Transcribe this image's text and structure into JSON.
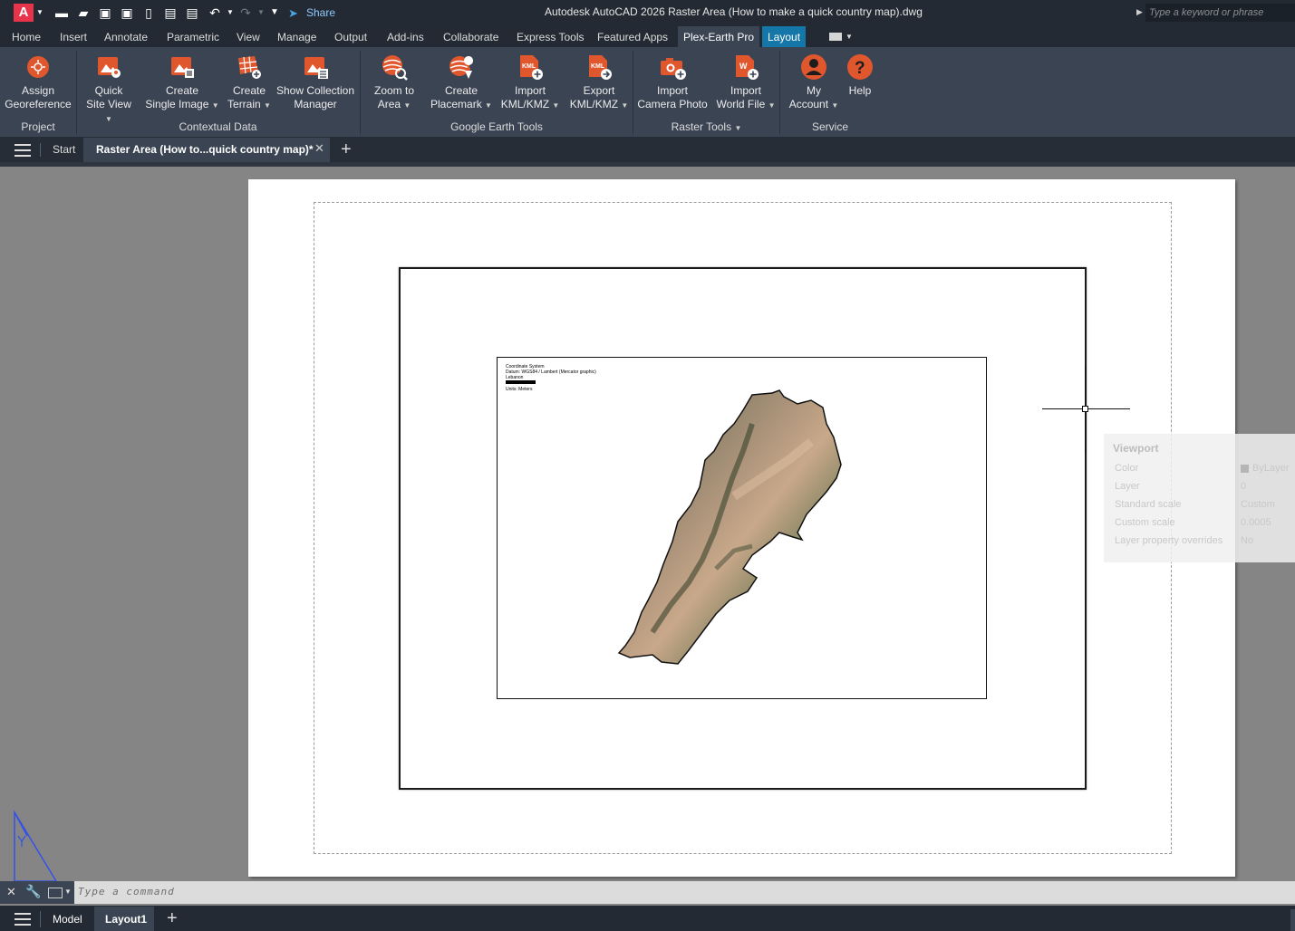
{
  "window": {
    "app_icon_letter": "A",
    "title": "Autodesk AutoCAD 2026    Raster Area (How to make a quick country map).dwg",
    "share_label": "Share",
    "search_placeholder": "Type a keyword or phrase"
  },
  "menu_tabs": [
    "Home",
    "Insert",
    "Annotate",
    "Parametric",
    "View",
    "Manage",
    "Output",
    "Add-ins",
    "Collaborate",
    "Express Tools",
    "Featured Apps",
    "Plex-Earth Pro",
    "Layout"
  ],
  "ribbon": {
    "panels": [
      {
        "title": "Project",
        "buttons": [
          [
            "Assign",
            "Georeference"
          ]
        ]
      },
      {
        "title": "Contextual Data",
        "buttons": [
          [
            "Quick",
            "Site View"
          ],
          [
            "Create",
            "Single Image"
          ],
          [
            "Create",
            "Terrain"
          ],
          [
            "Show Collection",
            "Manager"
          ]
        ]
      },
      {
        "title": "Google Earth Tools",
        "buttons": [
          [
            "Zoom to",
            "Area"
          ],
          [
            "Create",
            "Placemark"
          ],
          [
            "Import",
            "KML/KMZ"
          ],
          [
            "Export",
            "KML/KMZ"
          ]
        ]
      },
      {
        "title": "Raster Tools",
        "buttons": [
          [
            "Import",
            "Camera Photo"
          ],
          [
            "Import",
            "World File"
          ]
        ]
      },
      {
        "title": "Service",
        "buttons": [
          [
            "My",
            "Account"
          ],
          [
            "Help",
            ""
          ]
        ]
      }
    ],
    "kml_badge": "KML",
    "w_badge": "W"
  },
  "doc_tabs": {
    "start": "Start",
    "active": "Raster Area (How to...quick country map)*"
  },
  "map_legend": [
    "Coordinate System",
    "Datum: WGS84 / Lambert (Mercator graphic)",
    "Lebanon",
    "",
    "Units: Meters"
  ],
  "viewport_props": {
    "title": "Viewport",
    "rows": [
      {
        "label": "Color",
        "value": "ByLayer"
      },
      {
        "label": "Layer",
        "value": "0"
      },
      {
        "label": "Standard scale",
        "value": "Custom"
      },
      {
        "label": "Custom scale",
        "value": "0.0005"
      },
      {
        "label": "Layer property overrides",
        "value": "No"
      }
    ]
  },
  "command": {
    "placeholder": "Type  a  command"
  },
  "layout_tabs": [
    "Model",
    "Layout1"
  ],
  "colors": {
    "accent_orange": "#e0572e",
    "layout_tab": "#1576a8",
    "ribbon_bg": "#3b4453"
  }
}
